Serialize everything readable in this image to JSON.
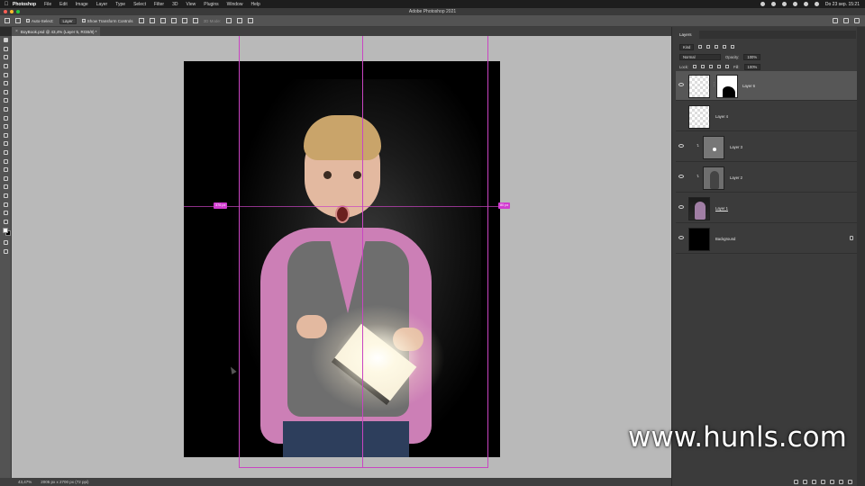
{
  "menubar": {
    "app": "Photoshop",
    "items": [
      "File",
      "Edit",
      "Image",
      "Layer",
      "Type",
      "Select",
      "Filter",
      "3D",
      "View",
      "Plugins",
      "Window",
      "Help"
    ],
    "clock": "Do 23 sep.  15:21"
  },
  "window": {
    "title": "Adobe Photoshop 2021",
    "lights": [
      "#ff5f57",
      "#febc2e",
      "#28c840"
    ]
  },
  "options": {
    "auto_select_label": "Auto-Select:",
    "auto_select_value": "Layer",
    "transform_controls": "Show Transform Controls",
    "mode_3d": "3D Mode:"
  },
  "document": {
    "tab_label": "BoyBook.psd @ 43,4% (Layer 5, RGB/8) *",
    "close_glyph": "×"
  },
  "guides": {
    "left_measure": "376 px",
    "right_measure": "80 px",
    "guide_color": "#c945c2"
  },
  "status": {
    "zoom": "43,47%",
    "dimensions": "2005 px x 2700 px (72 ppi)"
  },
  "layers_panel": {
    "tab": "Layers",
    "kind_filter": "Kind",
    "blend_mode": "Normal",
    "opacity_label": "Opacity:",
    "opacity_value": "100%",
    "lock_label": "Lock:",
    "fill_label": "Fill:",
    "fill_value": "100%",
    "layers": [
      {
        "name": "Layer 6",
        "selected": true
      },
      {
        "name": "Layer 4",
        "selected": false
      },
      {
        "name": "Layer 3",
        "selected": false
      },
      {
        "name": "Layer 2",
        "selected": false
      },
      {
        "name": "Layer 1",
        "selected": false
      },
      {
        "name": "Background",
        "selected": false
      }
    ]
  },
  "watermark": "www.hunls.com"
}
